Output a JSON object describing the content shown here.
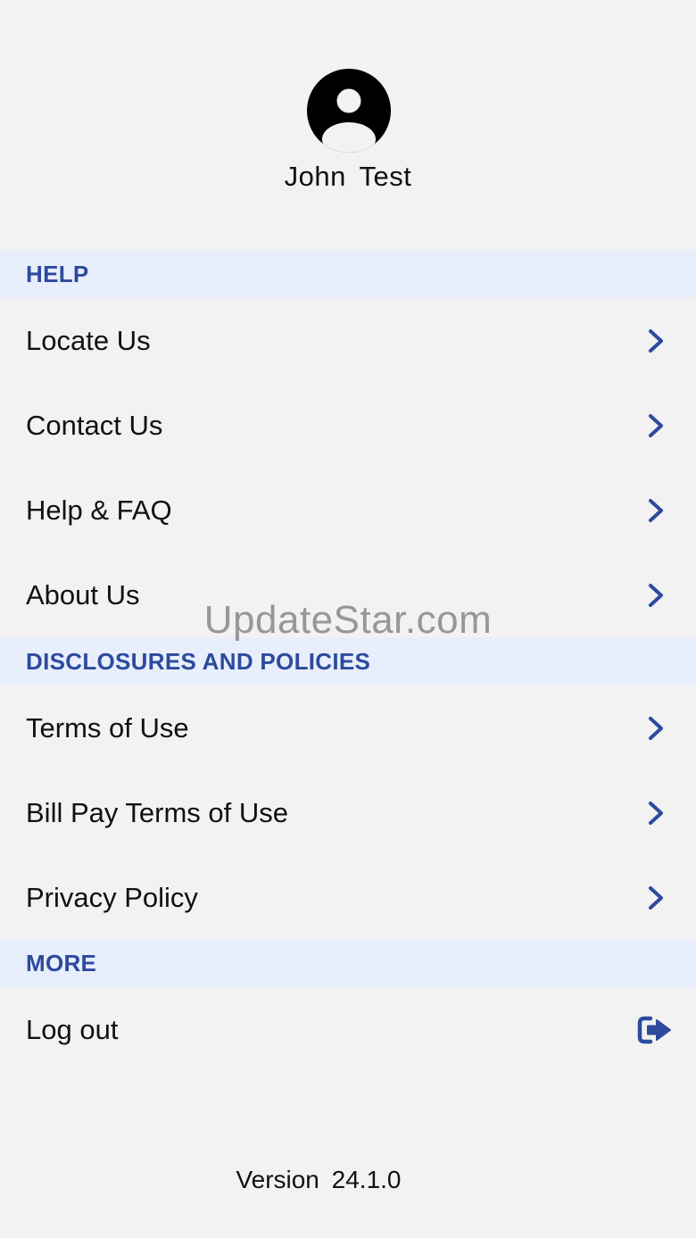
{
  "profile": {
    "name": "John  Test",
    "avatar_icon": "user-circle-icon"
  },
  "sections": [
    {
      "title": "HELP",
      "items": [
        {
          "label": "Locate Us",
          "icon": "chevron-right-icon"
        },
        {
          "label": "Contact Us",
          "icon": "chevron-right-icon"
        },
        {
          "label": "Help & FAQ",
          "icon": "chevron-right-icon"
        },
        {
          "label": "About Us",
          "icon": "chevron-right-icon"
        }
      ]
    },
    {
      "title": "DISCLOSURES AND POLICIES",
      "items": [
        {
          "label": "Terms of Use",
          "icon": "chevron-right-icon"
        },
        {
          "label": "Bill Pay Terms of Use",
          "icon": "chevron-right-icon"
        },
        {
          "label": "Privacy Policy",
          "icon": "chevron-right-icon"
        }
      ]
    },
    {
      "title": "MORE",
      "items": [
        {
          "label": "Log out",
          "icon": "logout-icon"
        }
      ]
    }
  ],
  "watermark": "UpdateStar.com",
  "footer": {
    "version": "Version  24.1.0"
  },
  "colors": {
    "background": "#f2f2f2",
    "section_header_bg": "#e8eefc",
    "accent": "#2d4a9d",
    "text": "#111111"
  }
}
